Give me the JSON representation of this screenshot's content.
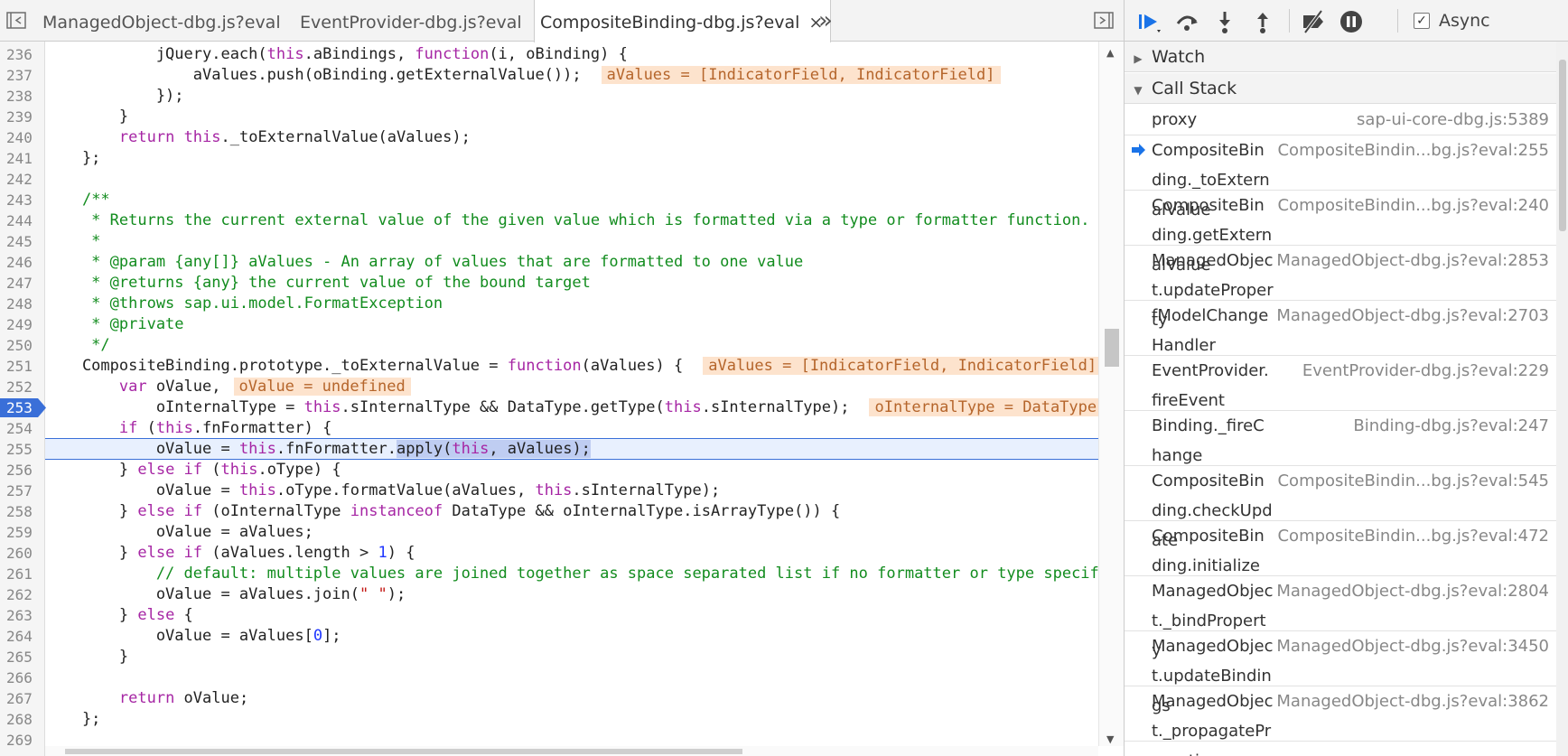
{
  "tabs": [
    {
      "label": "ManagedObject-dbg.js?eval",
      "active": false
    },
    {
      "label": "EventProvider-dbg.js?eval",
      "active": false
    },
    {
      "label": "CompositeBinding-dbg.js?eval",
      "active": true,
      "close": "×"
    }
  ],
  "more_tabs": "»",
  "editor": {
    "current_line": 255,
    "breakpoint_line": 253,
    "lines": [
      {
        "n": "236",
        "html": "            jQuery.each(<span class=\"th\">this</span>.aBindings, <span class=\"kw\">function</span>(i, oBinding) {"
      },
      {
        "n": "237",
        "html": "                aValues.push(oBinding.getExternalValue());<span class=\"iv\">aValues = [IndicatorField, IndicatorField]</span>"
      },
      {
        "n": "238",
        "html": "            });"
      },
      {
        "n": "239",
        "html": "        }"
      },
      {
        "n": "240",
        "html": "        <span class=\"kw\">return</span> <span class=\"th\">this</span>._toExternalValue(aValues);"
      },
      {
        "n": "241",
        "html": "    };"
      },
      {
        "n": "242",
        "html": ""
      },
      {
        "n": "243",
        "html": "    <span class=\"cm\">/**</span>"
      },
      {
        "n": "244",
        "html": "<span class=\"cm\">     * Returns the current external value of the given value which is formatted via a type or formatter function.</span>"
      },
      {
        "n": "245",
        "html": "<span class=\"cm\">     *</span>"
      },
      {
        "n": "246",
        "html": "<span class=\"cm\">     * @param {any[]} aValues - An array of values that are formatted to one value</span>"
      },
      {
        "n": "247",
        "html": "<span class=\"cm\">     * @returns {any} the current value of the bound target</span>"
      },
      {
        "n": "248",
        "html": "<span class=\"cm\">     * @throws sap.ui.model.FormatException</span>"
      },
      {
        "n": "249",
        "html": "<span class=\"cm\">     * @private</span>"
      },
      {
        "n": "250",
        "html": "<span class=\"cm\">     */</span>"
      },
      {
        "n": "251",
        "html": "    CompositeBinding.prototype._toExternalValue = <span class=\"kw\">function</span>(aValues) {<span class=\"iv\">aValues = [IndicatorField, IndicatorField]</span>"
      },
      {
        "n": "252",
        "html": "        <span class=\"kw\">var</span> oValue,<span class=\"iv\" style=\"margin-left:14px\">oValue = undefined</span>"
      },
      {
        "n": "253",
        "html": "            oInternalType = <span class=\"th\">this</span>.sInternalType &amp;&amp; DataType.getType(<span class=\"th\">this</span>.sInternalType);<span class=\"iv\">oInternalType = DataType</span>"
      },
      {
        "n": "254",
        "html": "        <span class=\"kw\">if</span> (<span class=\"th\">this</span>.fnFormatter) {"
      },
      {
        "n": "255",
        "html": "            oValue = <span class=\"th\">this</span>.fnFormatter.<span class=\"sel\">apply(<span class=\"th\">this</span>, aValues);</span>"
      },
      {
        "n": "256",
        "html": "        } <span class=\"kw\">else if</span> (<span class=\"th\">this</span>.oType) {"
      },
      {
        "n": "257",
        "html": "            oValue = <span class=\"th\">this</span>.oType.formatValue(aValues, <span class=\"th\">this</span>.sInternalType);"
      },
      {
        "n": "258",
        "html": "        } <span class=\"kw\">else if</span> (oInternalType <span class=\"kw\">instanceof</span> DataType &amp;&amp; oInternalType.isArrayType()) {"
      },
      {
        "n": "259",
        "html": "            oValue = aValues;"
      },
      {
        "n": "260",
        "html": "        } <span class=\"kw\">else if</span> (aValues.length &gt; <span class=\"nm\">1</span>) {"
      },
      {
        "n": "261",
        "html": "<span class=\"cm\">            // default: multiple values are joined together as space separated list if no formatter or type specified</span>"
      },
      {
        "n": "262",
        "html": "            oValue = aValues.join(<span class=\"str\">\" \"</span>);"
      },
      {
        "n": "263",
        "html": "        } <span class=\"kw\">else</span> {"
      },
      {
        "n": "264",
        "html": "            oValue = aValues[<span class=\"nm\">0</span>];"
      },
      {
        "n": "265",
        "html": "        }"
      },
      {
        "n": "266",
        "html": ""
      },
      {
        "n": "267",
        "html": "        <span class=\"kw\">return</span> oValue;"
      },
      {
        "n": "268",
        "html": "    };"
      },
      {
        "n": "269",
        "html": ""
      }
    ]
  },
  "debugger": {
    "async_label": "Async",
    "async_checked": "✓",
    "watch_label": "Watch",
    "callstack_label": "Call Stack",
    "frames": [
      {
        "name": "proxy",
        "location": "sap-ui-core-dbg.js:5389",
        "current": false
      },
      {
        "name": "CompositeBinding._toExternalValue",
        "location": "CompositeBindin...bg.js?eval:255",
        "current": true
      },
      {
        "name": "CompositeBinding.getExternalValue",
        "location": "CompositeBindin...bg.js?eval:240",
        "current": false
      },
      {
        "name": "ManagedObject.updateProperty",
        "location": "ManagedObject-dbg.js?eval:2853",
        "current": false
      },
      {
        "name": "fModelChangeHandler",
        "location": "ManagedObject-dbg.js?eval:2703",
        "current": false
      },
      {
        "name": "EventProvider.fireEvent",
        "location": "EventProvider-dbg.js?eval:229",
        "current": false
      },
      {
        "name": "Binding._fireChange",
        "location": "Binding-dbg.js?eval:247",
        "current": false
      },
      {
        "name": "CompositeBinding.checkUpdate",
        "location": "CompositeBindin...bg.js?eval:545",
        "current": false
      },
      {
        "name": "CompositeBinding.initialize",
        "location": "CompositeBindin...bg.js?eval:472",
        "current": false
      },
      {
        "name": "ManagedObject._bindProperty",
        "location": "ManagedObject-dbg.js?eval:2804",
        "current": false
      },
      {
        "name": "ManagedObject.updateBindings",
        "location": "ManagedObject-dbg.js?eval:3450",
        "current": false
      },
      {
        "name": "ManagedObject._propagateProperties",
        "location": "ManagedObject-dbg.js?eval:3862",
        "current": false
      }
    ]
  },
  "colors": {
    "accent": "#1a73e8",
    "breakpoint": "#3a6fd8",
    "inline_value_bg": "#fde3cd"
  }
}
